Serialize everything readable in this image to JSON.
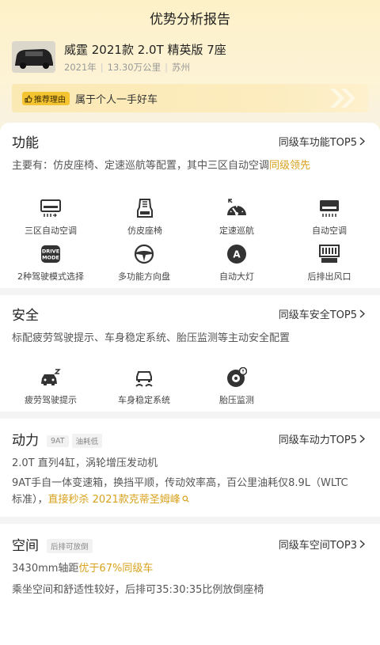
{
  "header": {
    "title": "优势分析报告"
  },
  "car": {
    "name": "威霆 2021款 2.0T 精英版 7座",
    "year": "2021年",
    "mileage": "13.30万公里",
    "city": "苏州"
  },
  "reason": {
    "tag": "推荐理由",
    "text": "属于个人一手好车"
  },
  "features_section": {
    "title": "功能",
    "link": "同级车功能TOP5",
    "desc_prefix": "主要有：仿皮座椅、定速巡航等配置，其中三区自动空调",
    "desc_highlight": "同级领先",
    "items": [
      {
        "label": "三区自动空调",
        "icon": "ac-vent-icon"
      },
      {
        "label": "仿皮座椅",
        "icon": "seat-icon"
      },
      {
        "label": "定速巡航",
        "icon": "speedometer-icon"
      },
      {
        "label": "自动空调",
        "icon": "ac-unit-icon"
      },
      {
        "label": "2种驾驶模式选择",
        "icon": "drive-mode-icon"
      },
      {
        "label": "多功能方向盘",
        "icon": "steering-wheel-icon"
      },
      {
        "label": "自动大灯",
        "icon": "auto-headlight-icon"
      },
      {
        "label": "后排出风口",
        "icon": "rear-vent-icon"
      }
    ],
    "drive_mode_text": "DRIVE\nMODE",
    "auto_light_letter": "A"
  },
  "safety_section": {
    "title": "安全",
    "link": "同级车安全TOP5",
    "desc": "标配疲劳驾驶提示、车身稳定系统、胎压监测等主动安全配置",
    "items": [
      {
        "label": "疲劳驾驶提示",
        "icon": "fatigue-alert-icon"
      },
      {
        "label": "车身稳定系统",
        "icon": "stability-control-icon"
      },
      {
        "label": "胎压监测",
        "icon": "tire-pressure-icon"
      }
    ]
  },
  "power_section": {
    "title": "动力",
    "tags": [
      "9AT",
      "油耗低"
    ],
    "link": "同级车动力TOP5",
    "engine": "2.0T 直列4缸，涡轮增压发动机",
    "desc_line1": "9AT手自一体变速箱，换挡平顺，传动效率高，百公里油耗仅8.9L（WLTC",
    "desc_line2_prefix": "标准），",
    "desc_line2_highlight": "直接秒杀 2021款克蒂圣姆峰"
  },
  "space_section": {
    "title": "空间",
    "tags": [
      "后排可放倒"
    ],
    "link": "同级车空间TOP3",
    "wheelbase_prefix": "3430mm轴距",
    "wheelbase_highlight": "优于67%同级车",
    "desc": "乘坐空间和舒适性较好，后排可35:30:35比例放倒座椅"
  },
  "colors": {
    "accent": "#d9a21d",
    "tag_yellow": "#f4c430"
  }
}
